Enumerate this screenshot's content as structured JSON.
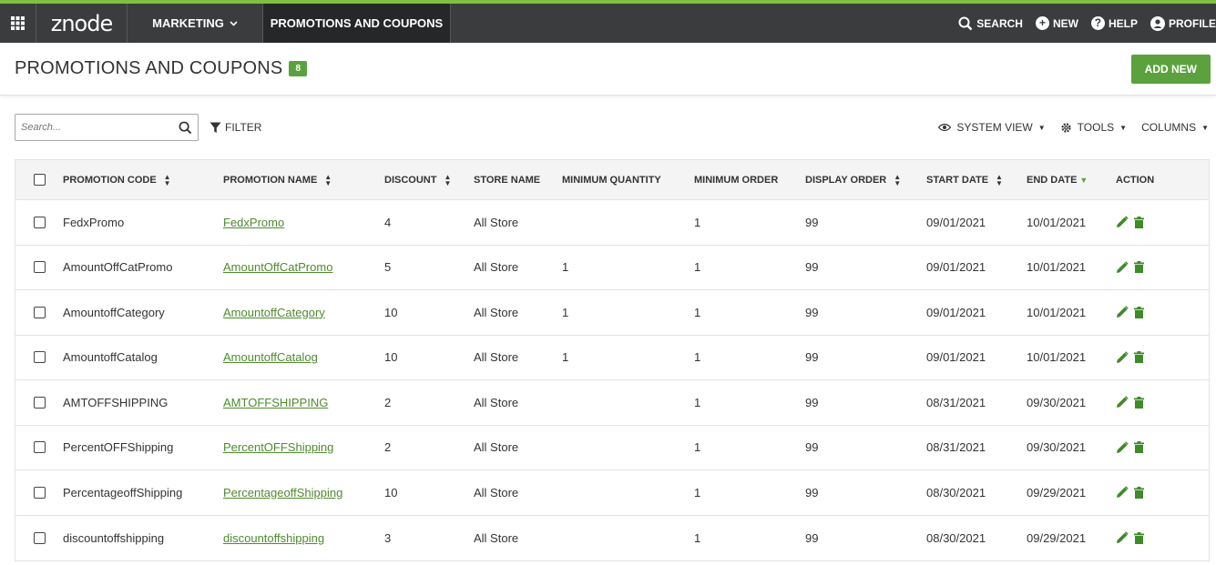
{
  "nav": {
    "logo": "znode",
    "marketing": "MARKETING",
    "active_tab": "PROMOTIONS AND COUPONS",
    "search": "SEARCH",
    "new": "NEW",
    "help": "HELP",
    "profile": "PROFILE"
  },
  "header": {
    "title": "PROMOTIONS AND COUPONS",
    "count": "8",
    "add_new": "ADD NEW"
  },
  "toolbar": {
    "search_placeholder": "Search...",
    "filter": "FILTER",
    "system_view": "SYSTEM VIEW",
    "tools": "TOOLS",
    "columns": "COLUMNS"
  },
  "table": {
    "columns": {
      "code": "PROMOTION CODE",
      "name": "PROMOTION NAME",
      "discount": "DISCOUNT",
      "store": "STORE NAME",
      "min_qty": "MINIMUM QUANTITY",
      "min_order": "MINIMUM ORDER",
      "display_order": "DISPLAY ORDER",
      "start": "START DATE",
      "end": "END DATE",
      "action": "ACTION"
    },
    "rows": [
      {
        "code": "FedxPromo",
        "name": "FedxPromo",
        "discount": "4",
        "store": "All Store",
        "min_qty": "",
        "min_order": "1",
        "display_order": "99",
        "start": "09/01/2021",
        "end": "10/01/2021"
      },
      {
        "code": "AmountOffCatPromo",
        "name": "AmountOffCatPromo",
        "discount": "5",
        "store": "All Store",
        "min_qty": "1",
        "min_order": "1",
        "display_order": "99",
        "start": "09/01/2021",
        "end": "10/01/2021"
      },
      {
        "code": "AmountoffCategory",
        "name": "AmountoffCategory",
        "discount": "10",
        "store": "All Store",
        "min_qty": "1",
        "min_order": "1",
        "display_order": "99",
        "start": "09/01/2021",
        "end": "10/01/2021"
      },
      {
        "code": "AmountoffCatalog",
        "name": "AmountoffCatalog",
        "discount": "10",
        "store": "All Store",
        "min_qty": "1",
        "min_order": "1",
        "display_order": "99",
        "start": "09/01/2021",
        "end": "10/01/2021"
      },
      {
        "code": "AMTOFFSHIPPING",
        "name": "AMTOFFSHIPPING",
        "discount": "2",
        "store": "All Store",
        "min_qty": "",
        "min_order": "1",
        "display_order": "99",
        "start": "08/31/2021",
        "end": "09/30/2021"
      },
      {
        "code": "PercentOFFShipping",
        "name": "PercentOFFShipping",
        "discount": "2",
        "store": "All Store",
        "min_qty": "",
        "min_order": "1",
        "display_order": "99",
        "start": "08/31/2021",
        "end": "09/30/2021"
      },
      {
        "code": "PercentageoffShipping",
        "name": "PercentageoffShipping",
        "discount": "10",
        "store": "All Store",
        "min_qty": "",
        "min_order": "1",
        "display_order": "99",
        "start": "08/30/2021",
        "end": "09/29/2021"
      },
      {
        "code": "discountoffshipping",
        "name": "discountoffshipping",
        "discount": "3",
        "store": "All Store",
        "min_qty": "",
        "min_order": "1",
        "display_order": "99",
        "start": "08/30/2021",
        "end": "09/29/2021"
      }
    ]
  },
  "colors": {
    "accent": "#5ba23e",
    "nav_bg": "#3a3c3e"
  },
  "icons": {
    "grid": "apps-grid-icon",
    "search": "search-icon",
    "new": "plus-circle-icon",
    "help": "help-circle-icon",
    "profile": "user-circle-icon",
    "edit": "pencil-icon",
    "delete": "trash-icon"
  }
}
